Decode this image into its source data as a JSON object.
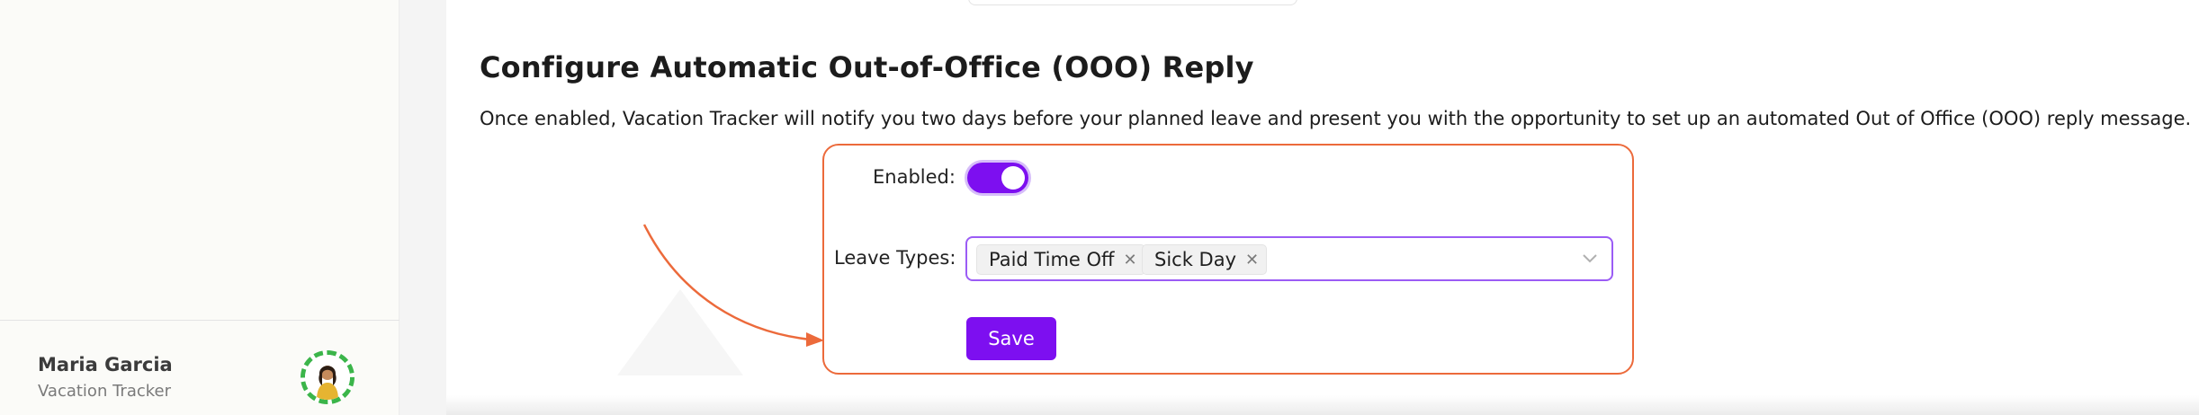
{
  "sidebar": {
    "user": {
      "name": "Maria Garcia",
      "subtitle": "Vacation Tracker",
      "avatar_icon": "user-avatar-icon",
      "avatar_ring_color": "#3bb54a"
    }
  },
  "main": {
    "title": "Configure Automatic Out-of-Office (OOO) Reply",
    "description": "Once enabled, Vacation Tracker will notify you two days before your planned leave and present you with the opportunity to set up an automated Out of Office (OOO) reply message.",
    "form": {
      "enabled_label": "Enabled:",
      "enabled_value": true,
      "leave_types_label": "Leave Types:",
      "leave_types_selected": [
        "Paid Time Off",
        "Sick Day"
      ],
      "save_label": "Save",
      "highlight_color": "#ec6a3b",
      "accent_color": "#7d0ff0"
    }
  }
}
